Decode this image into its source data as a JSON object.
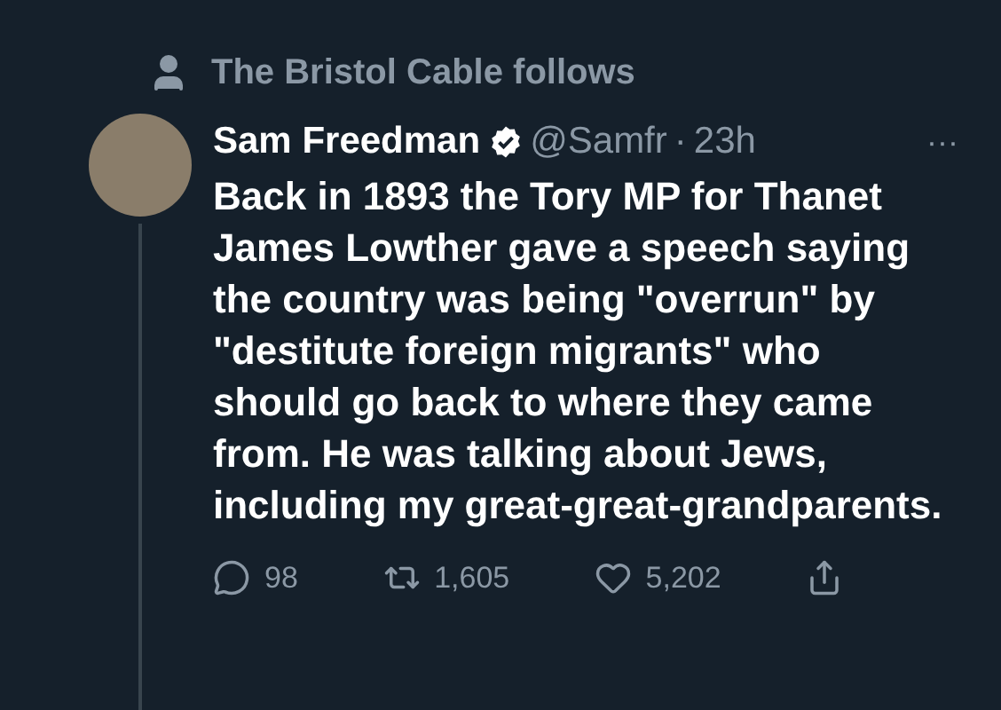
{
  "social_context": {
    "text": "The Bristol Cable follows"
  },
  "tweet": {
    "name": "Sam Freedman",
    "verified": true,
    "handle": "@Samfr",
    "separator": "·",
    "time": "23h",
    "more": "···",
    "body": "Back in 1893 the Tory MP for Thanet James Lowther gave a speech saying the country was being \"overrun\" by \"destitute foreign migrants\" who should go back to where they came from. He was talking about Jews, including my great-great-grandparents.",
    "actions": [
      {
        "kind": "reply",
        "count": "98"
      },
      {
        "kind": "retweet",
        "count": "1,605"
      },
      {
        "kind": "like",
        "count": "5,202"
      },
      {
        "kind": "share"
      }
    ]
  }
}
